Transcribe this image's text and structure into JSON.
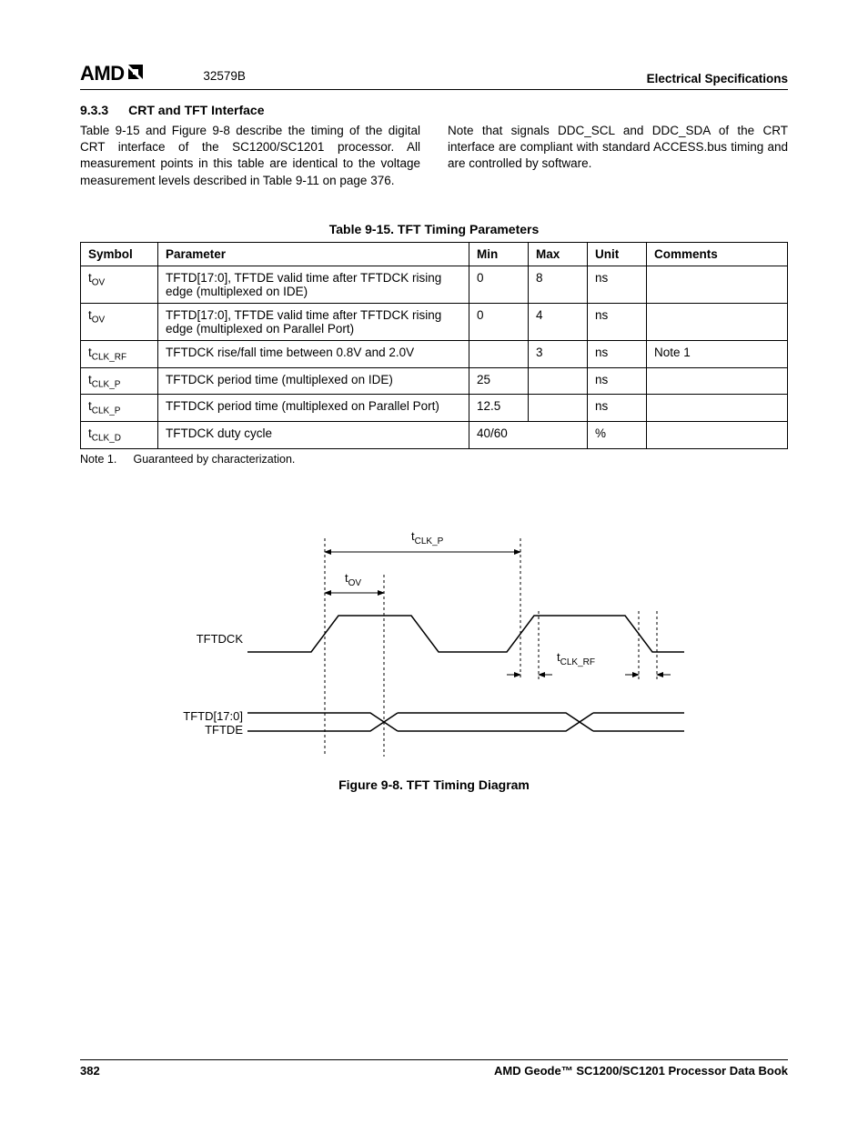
{
  "header": {
    "logo_text": "AMD",
    "doc_id": "32579B",
    "right": "Electrical Specifications"
  },
  "section": {
    "number": "9.3.3",
    "title": "CRT and TFT Interface"
  },
  "paragraphs": {
    "left": "Table 9-15 and Figure 9-8 describe the timing of the digital CRT interface of the SC1200/SC1201 processor. All measurement points in this table are identical to the voltage measurement levels described in Table 9-11 on page 376.",
    "right": "Note that signals DDC_SCL and DDC_SDA of the CRT interface are compliant with standard ACCESS.bus timing and are controlled by software."
  },
  "table": {
    "caption": "Table 9-15.  TFT Timing Parameters",
    "columns": {
      "symbol": "Symbol",
      "parameter": "Parameter",
      "min": "Min",
      "max": "Max",
      "unit": "Unit",
      "comments": "Comments"
    },
    "rows": [
      {
        "sym_base": "t",
        "sym_sub": "OV",
        "param": "TFTD[17:0], TFTDE valid time after TFTDCK rising edge (multiplexed on IDE)",
        "min": "0",
        "max": "8",
        "unit": "ns",
        "comments": ""
      },
      {
        "sym_base": "t",
        "sym_sub": "OV",
        "param": "TFTD[17:0], TFTDE valid time after TFTDCK rising edge (multiplexed on Parallel Port)",
        "min": "0",
        "max": "4",
        "unit": "ns",
        "comments": ""
      },
      {
        "sym_base": "t",
        "sym_sub": "CLK_RF",
        "param": "TFTDCK rise/fall time between 0.8V and 2.0V",
        "min": "",
        "max": "3",
        "unit": "ns",
        "comments": "Note 1"
      },
      {
        "sym_base": "t",
        "sym_sub": "CLK_P",
        "param": "TFTDCK period time (multiplexed on IDE)",
        "min": "25",
        "max": "",
        "unit": "ns",
        "comments": ""
      },
      {
        "sym_base": "t",
        "sym_sub": "CLK_P",
        "param": "TFTDCK period time (multiplexed on Parallel Port)",
        "min": "12.5",
        "max": "",
        "unit": "ns",
        "comments": ""
      },
      {
        "sym_base": "t",
        "sym_sub": "CLK_D",
        "param": "TFTDCK duty cycle",
        "minmax": "40/60",
        "unit": "%",
        "comments": ""
      }
    ],
    "note_label": "Note 1.",
    "note_text": "Guaranteed by characterization."
  },
  "figure": {
    "labels": {
      "tclk_p_base": "t",
      "tclk_p_sub": "CLK_P",
      "tov_base": "t",
      "tov_sub": "OV",
      "tclk_rf_base": "t",
      "tclk_rf_sub": "CLK_RF",
      "tftdck": "TFTDCK",
      "tftd": "TFTD[17:0]",
      "tftde": "TFTDE"
    },
    "caption": "Figure 9-8.  TFT Timing Diagram"
  },
  "footer": {
    "page": "382",
    "book": "AMD Geode™ SC1200/SC1201 Processor Data Book"
  }
}
